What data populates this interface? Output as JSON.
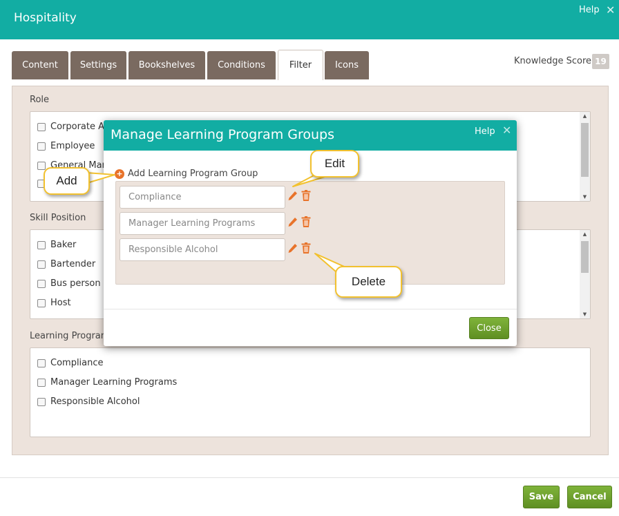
{
  "header": {
    "title": "Hospitality",
    "help": "Help",
    "close_icon": "✕"
  },
  "tabs": [
    {
      "label": "Content",
      "active": false
    },
    {
      "label": "Settings",
      "active": false
    },
    {
      "label": "Bookshelves",
      "active": false
    },
    {
      "label": "Conditions",
      "active": false
    },
    {
      "label": "Filter",
      "active": true
    },
    {
      "label": "Icons",
      "active": false
    }
  ],
  "knowledge_score": {
    "label": "Knowledge Score",
    "value": "19"
  },
  "filter": {
    "role": {
      "label": "Role",
      "items": [
        "Corporate Ad",
        "Employee",
        "General Man"
      ]
    },
    "skill_position": {
      "label": "Skill Position",
      "items": [
        "Baker",
        "Bartender",
        "Bus person",
        "Host"
      ]
    },
    "learning_program": {
      "label": "Learning Program",
      "items": [
        "Compliance",
        "Manager Learning Programs",
        "Responsible Alcohol"
      ]
    }
  },
  "footer": {
    "save": "Save",
    "cancel": "Cancel"
  },
  "modal": {
    "title": "Manage Learning Program Groups",
    "help": "Help",
    "close_icon": "✕",
    "add_label": "Add Learning Program Group",
    "groups": [
      "Compliance",
      "Manager Learning Programs",
      "Responsible Alcohol"
    ],
    "close_button": "Close"
  },
  "callouts": {
    "add": "Add",
    "edit": "Edit",
    "delete": "Delete"
  },
  "colors": {
    "teal": "#12ada3",
    "tab_brown": "#7a6a60",
    "panel": "#ede3dc",
    "green": "#6fa22d",
    "orange": "#e8732a",
    "callout_border": "#f2c12e"
  }
}
